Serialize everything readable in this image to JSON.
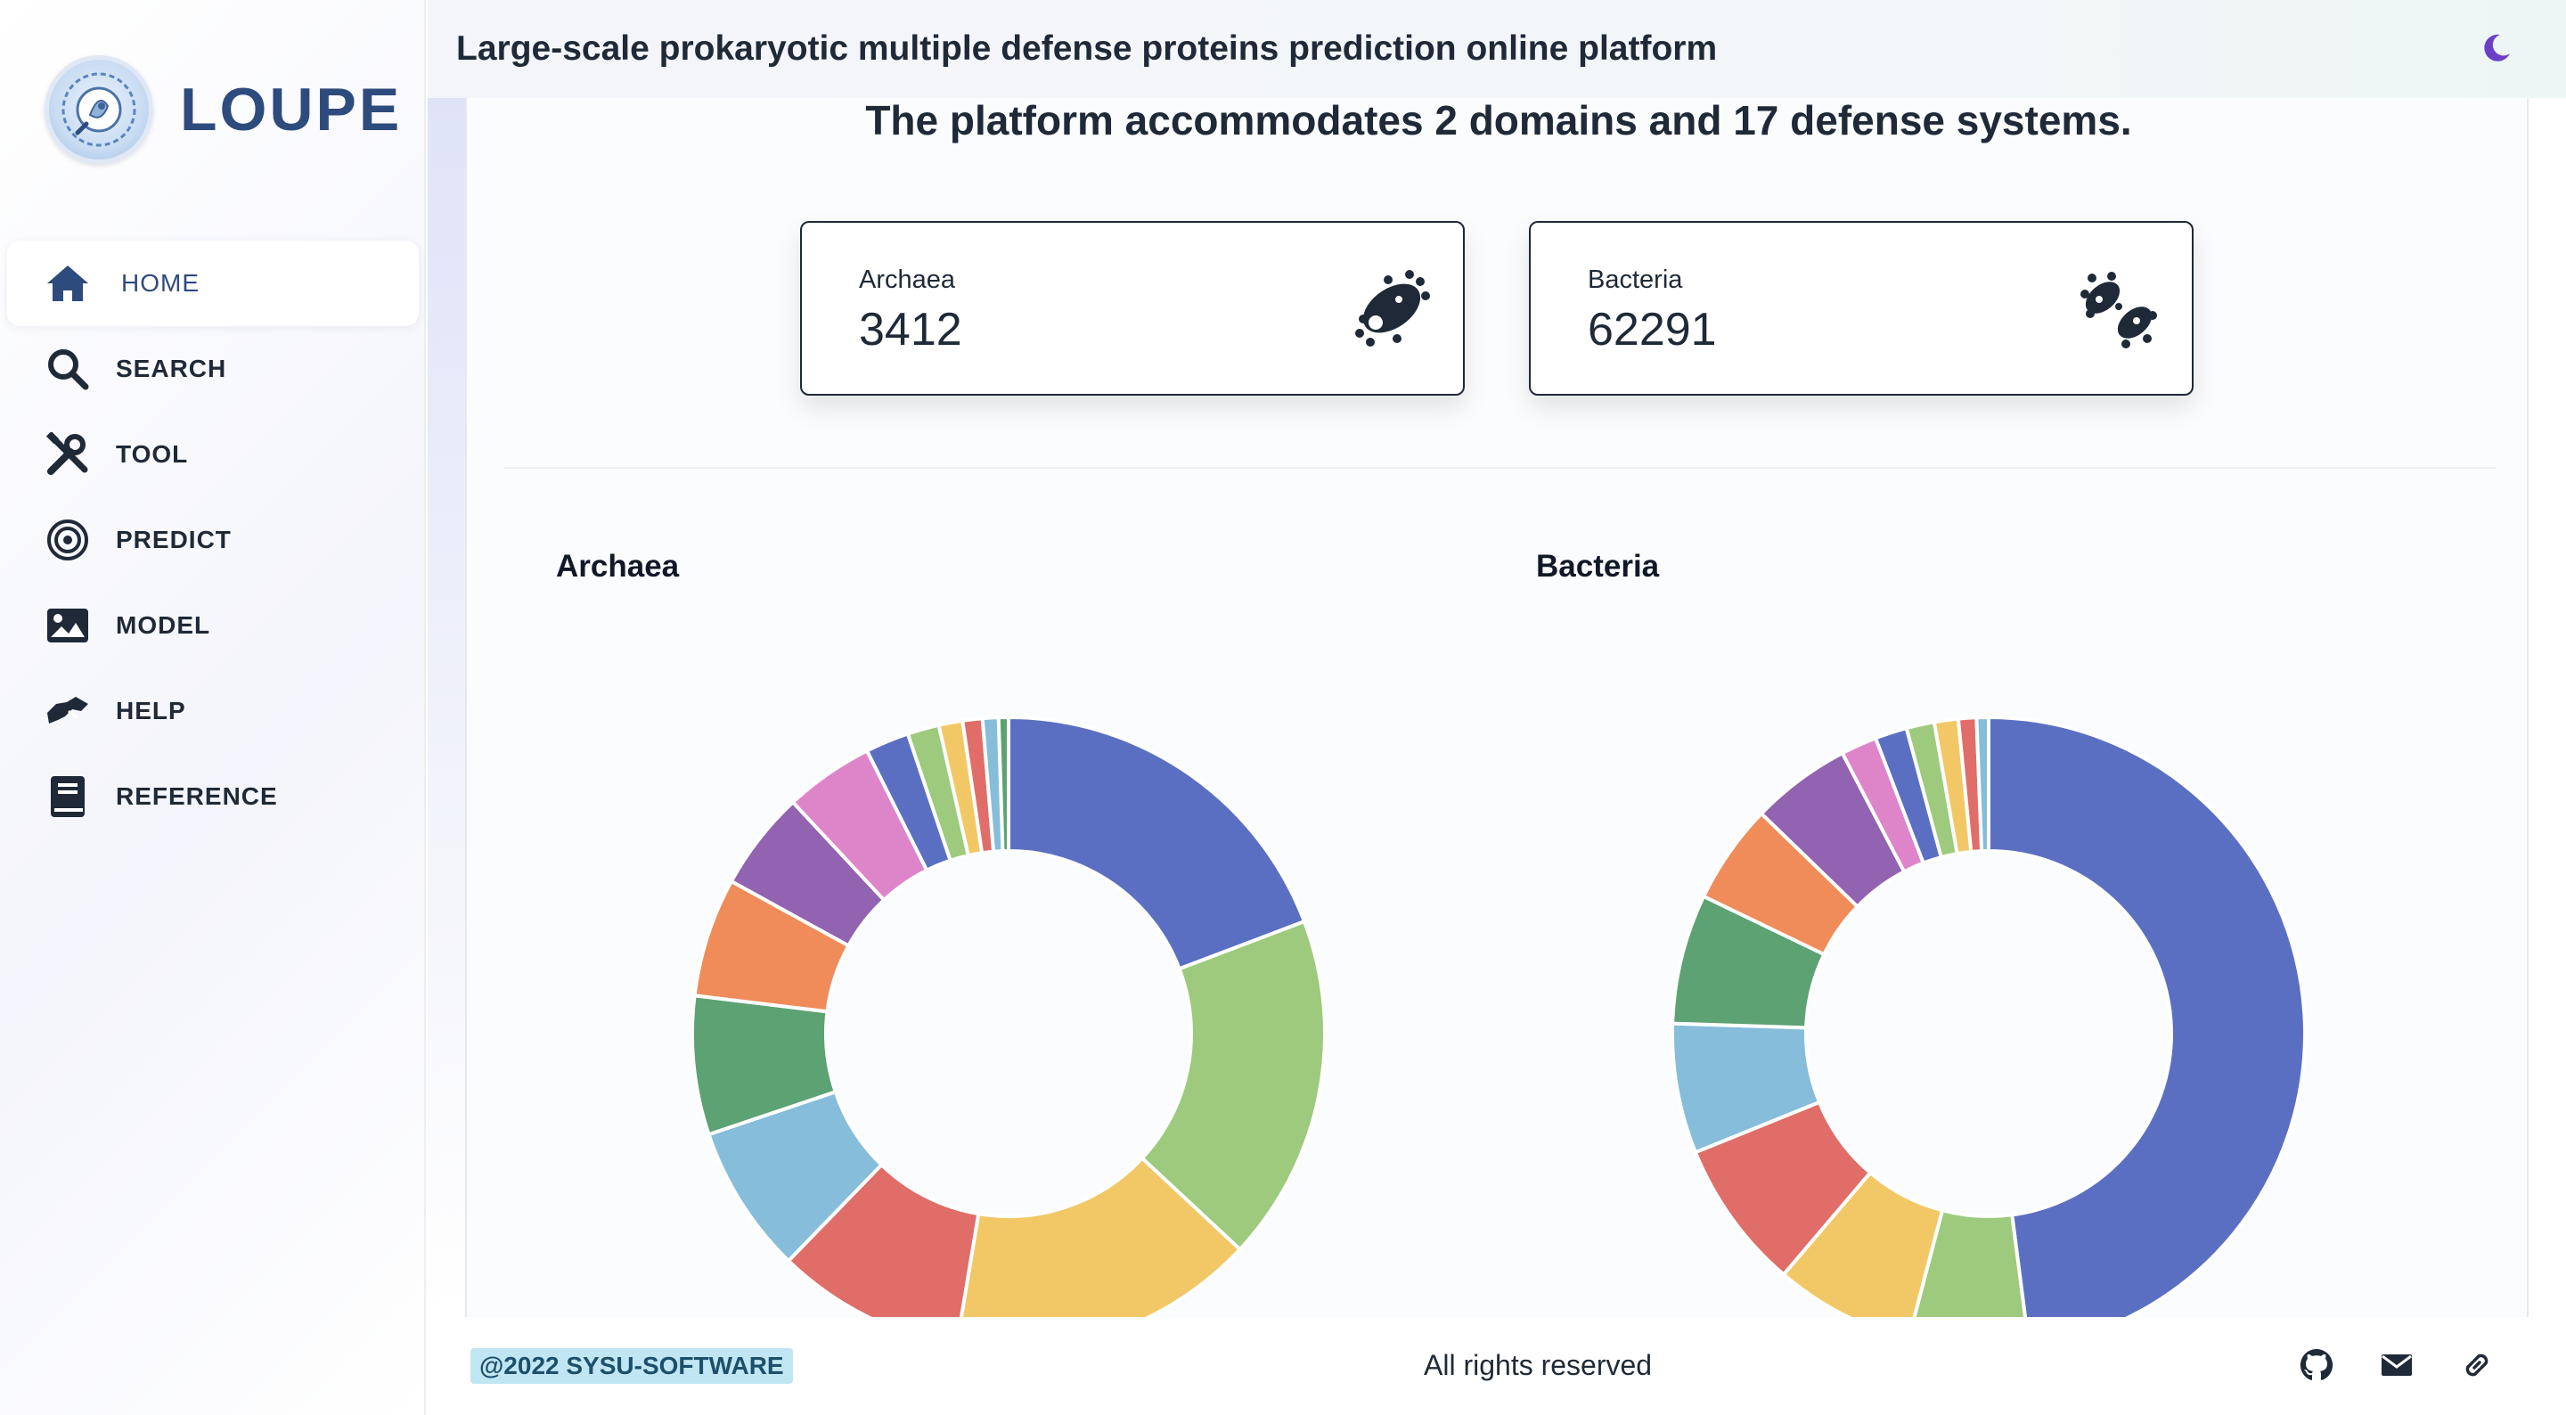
{
  "sidebar": {
    "brand": "LOUPE",
    "items": [
      {
        "label": "HOME",
        "icon": "home-icon"
      },
      {
        "label": "SEARCH",
        "icon": "search-icon"
      },
      {
        "label": "TOOL",
        "icon": "tools-icon"
      },
      {
        "label": "PREDICT",
        "icon": "target-icon"
      },
      {
        "label": "MODEL",
        "icon": "image-icon"
      },
      {
        "label": "HELP",
        "icon": "handshake-icon"
      },
      {
        "label": "REFERENCE",
        "icon": "book-icon"
      }
    ]
  },
  "header": {
    "title": "Large-scale prokaryotic multiple defense proteins prediction online platform",
    "theme_icon": "moon-icon"
  },
  "main": {
    "headline": "The platform accommodates 2 domains and 17 defense systems.",
    "stats": [
      {
        "label": "Archaea",
        "value": "3412",
        "icon": "archaea-microbe-icon"
      },
      {
        "label": "Bacteria",
        "value": "62291",
        "icon": "bacteria-microbe-icon"
      }
    ]
  },
  "chart_data": [
    {
      "type": "pie",
      "title": "Archaea",
      "donut": true,
      "values": [
        19.0,
        17.5,
        15.5,
        9.5,
        7.5,
        7.0,
        6.0,
        5.0,
        4.5,
        2.2,
        1.6,
        1.2,
        1.0,
        0.8,
        0.5
      ],
      "colors": [
        "#5b6fc2",
        "#9dca7c",
        "#f2c867",
        "#e06d68",
        "#85bddb",
        "#5ca273",
        "#ef8c5a",
        "#9163b0",
        "#de85c9",
        "#5b6fc2",
        "#9dca7c",
        "#f2c867",
        "#e06d68",
        "#85bddb",
        "#5ca273"
      ]
    },
    {
      "type": "pie",
      "title": "Bacteria",
      "donut": true,
      "values": [
        47.0,
        6.0,
        7.0,
        7.5,
        6.5,
        6.5,
        5.0,
        5.0,
        1.8,
        1.6,
        1.4,
        1.2,
        0.9,
        0.6
      ],
      "colors": [
        "#5b6fc2",
        "#9dca7c",
        "#f2c867",
        "#e06d68",
        "#85bddb",
        "#5ca273",
        "#ef8c5a",
        "#9163b0",
        "#de85c9",
        "#5b6fc2",
        "#9dca7c",
        "#f2c867",
        "#e06d68",
        "#85bddb"
      ]
    }
  ],
  "footer": {
    "copyright": "@2022 SYSU-SOFTWARE",
    "rights": "All rights reserved",
    "icons": [
      "github-icon",
      "mail-icon",
      "link-icon"
    ]
  }
}
